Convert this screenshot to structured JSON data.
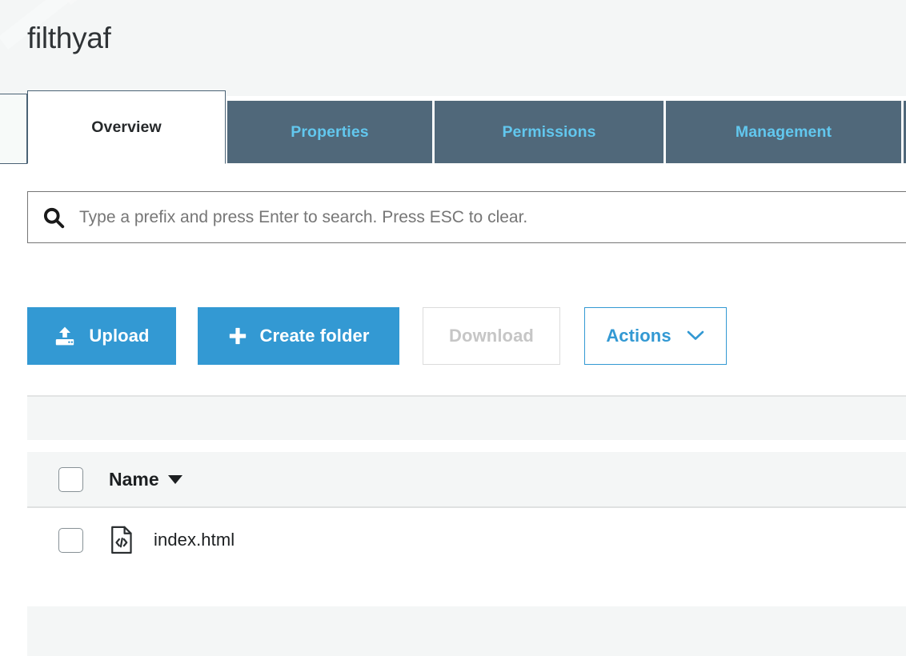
{
  "header": {
    "bucket_title": "filthyaf"
  },
  "tabs": [
    {
      "label": "Overview",
      "state": "active"
    },
    {
      "label": "Properties",
      "state": "inactive"
    },
    {
      "label": "Permissions",
      "state": "inactive"
    },
    {
      "label": "Management",
      "state": "inactive"
    }
  ],
  "search": {
    "placeholder": "Type a prefix and press Enter to search. Press ESC to clear.",
    "value": "",
    "icon": "search-icon"
  },
  "toolbar": {
    "upload_label": "Upload",
    "upload_icon": "upload-icon",
    "create_folder_label": "Create folder",
    "create_folder_icon": "plus-icon",
    "download_label": "Download",
    "download_disabled": true,
    "actions_label": "Actions",
    "actions_icon": "chevron-down-icon"
  },
  "table": {
    "select_all_checked": false,
    "columns": [
      {
        "label": "Name",
        "sorted": true,
        "sort_direction": "desc",
        "sort_icon": "caret-down-icon"
      }
    ],
    "rows": [
      {
        "checked": false,
        "name": "index.html",
        "icon": "html-file-icon"
      }
    ]
  },
  "colors": {
    "tab_inactive_bg": "#50687a",
    "tab_inactive_text": "#62c7ee",
    "tab_active_bg": "#ffffff",
    "tab_active_text": "#26292b",
    "primary_button": "#3399d3",
    "link_blue": "#3399d3",
    "disabled_text": "#c6c6c6",
    "header_band": "#f4f6f6",
    "table_band": "#f4f6f6",
    "page_bg": "#ffffff"
  }
}
